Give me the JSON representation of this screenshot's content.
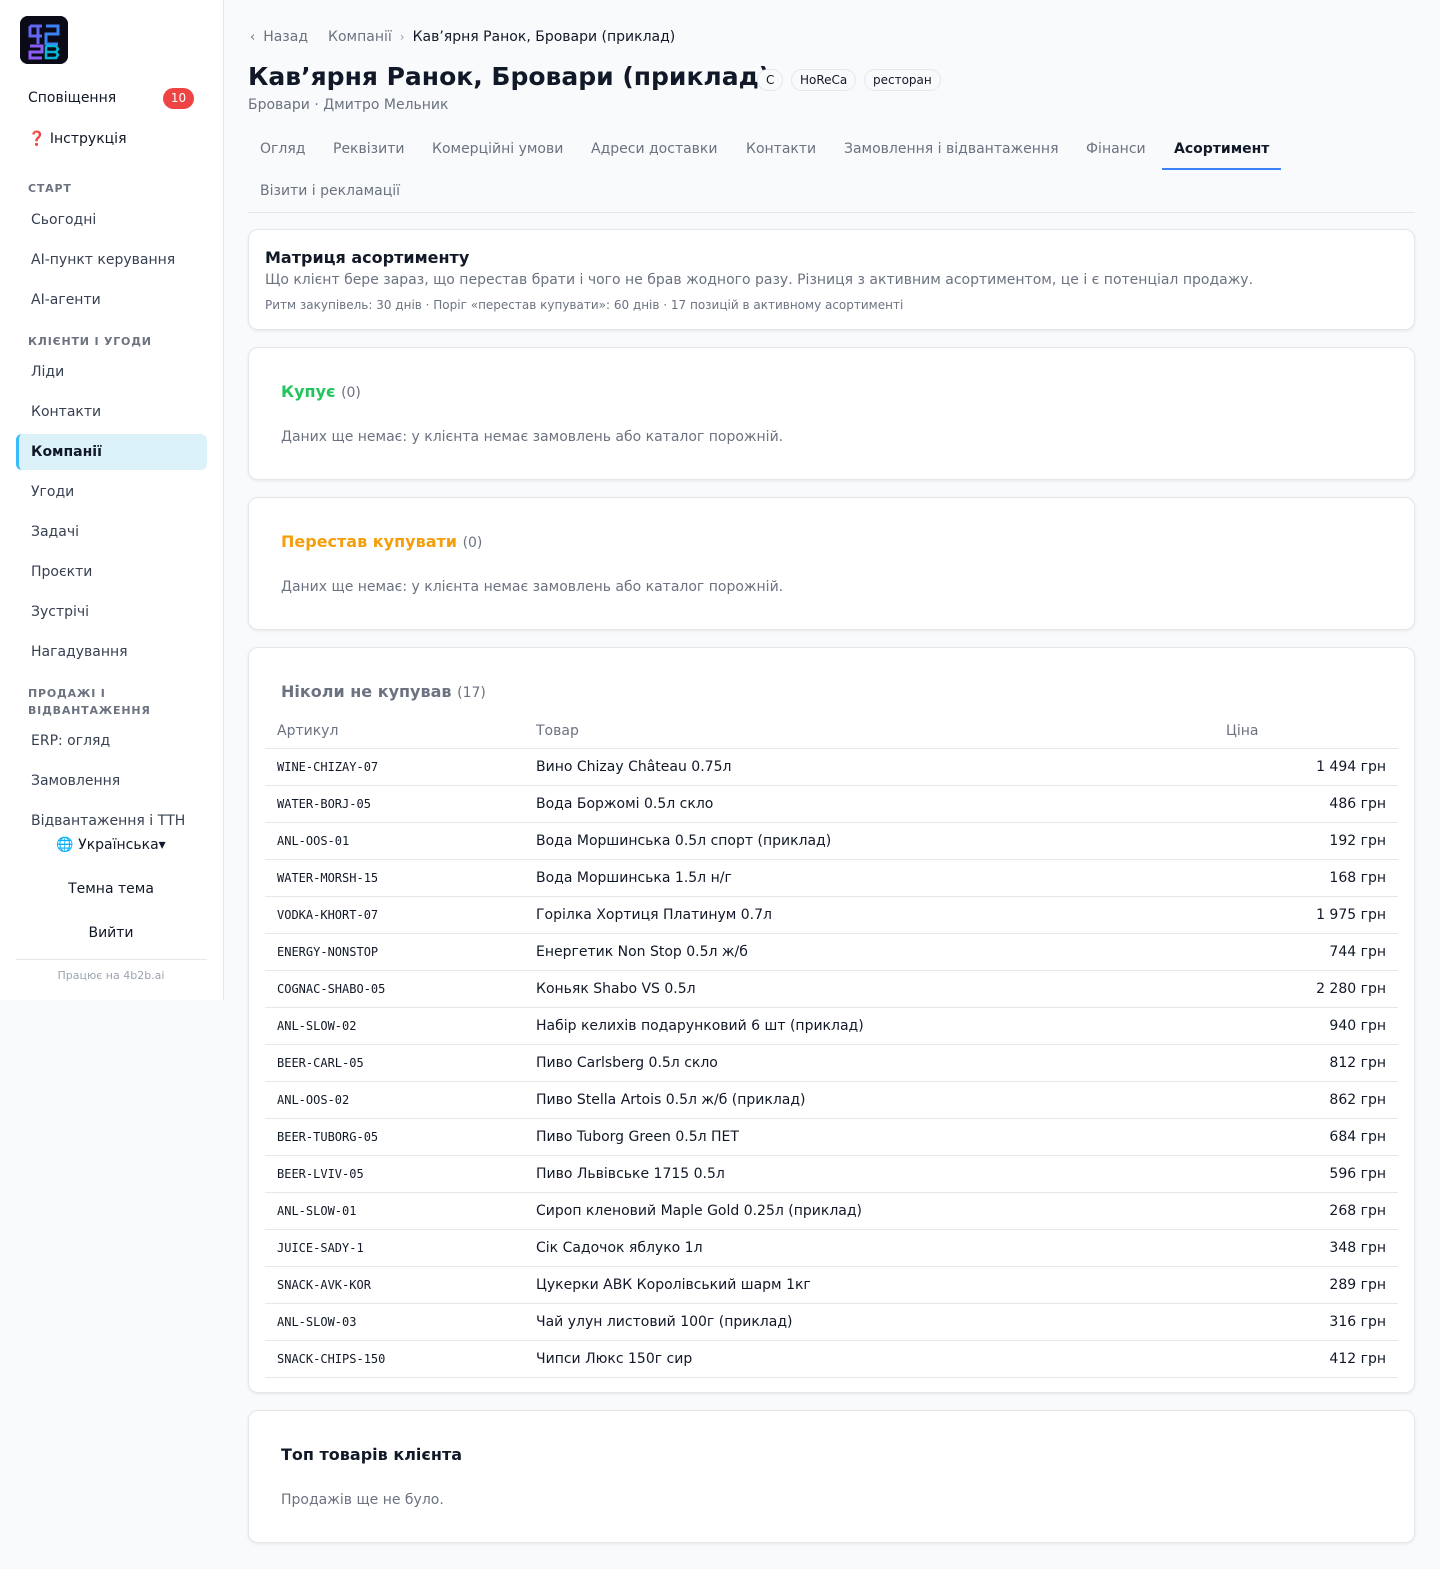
{
  "sidebar": {
    "logo_text": "4B2B",
    "notifications_label": "Сповіщення",
    "notifications_count": "10",
    "instruction_label": "❓ Інструкція",
    "sections": [
      {
        "label": "СТАРТ",
        "items": [
          "Сьогодні",
          "AI-пункт керування",
          "AI-агенти"
        ]
      },
      {
        "label": "КЛІЄНТИ І УГОДИ",
        "items": [
          "Ліди",
          "Контакти",
          "Компанії",
          "Угоди",
          "Задачі",
          "Проєкти",
          "Зустрічі",
          "Нагадування"
        ]
      },
      {
        "label": "ПРОДАЖІ І ВІДВАНТАЖЕННЯ",
        "items": [
          "ERP: огляд",
          "Замовлення",
          "Відвантаження і ТТН"
        ]
      }
    ],
    "language": "🌐 Українська▾",
    "theme_label": "Темна тема",
    "logout_label": "Вийти",
    "powered_by": "Працює на 4b2b.ai"
  },
  "breadcrumb": {
    "back": "Назад",
    "parent": "Компанії",
    "current": "Кав’ярня Ранок, Бровари (приклад)"
  },
  "company": {
    "title": "Кав’ярня Ранок, Бровари (приклад)",
    "chips": [
      "C",
      "HoReCa",
      "ресторан"
    ],
    "subtitle": "Бровари · Дмитро Мельник"
  },
  "tabs": [
    "Огляд",
    "Реквізити",
    "Комерційні умови",
    "Адреси доставки",
    "Контакти",
    "Замовлення і відвантаження",
    "Фінанси",
    "Асортимент",
    "Візити і рекламації"
  ],
  "active_tab": "Асортимент",
  "matrix": {
    "title": "Матриця асортименту",
    "description": "Що клієнт бере зараз, що перестав брати і чого не брав жодного разу. Різниця з активним асортиментом, це і є потенціал продажу.",
    "meta": "Ритм закупівель: 30 днів · Поріг «перестав купувати»: 60 днів · 17 позицій в активному асортименті"
  },
  "buying": {
    "title": "Купує",
    "count": "(0)",
    "empty": "Даних ще немає: у клієнта немає замовлень або каталог порожній.",
    "color": "#22c55e"
  },
  "stopped": {
    "title": "Перестав купувати",
    "count": "(0)",
    "empty": "Даних ще немає: у клієнта немає замовлень або каталог порожній.",
    "color": "#f59e0b"
  },
  "never": {
    "title": "Ніколи не купував",
    "count": "(17)",
    "columns": [
      "Артикул",
      "Товар",
      "Ціна"
    ],
    "rows": [
      {
        "sku": "WINE-CHIZAY-07",
        "name": "Вино Chizay Château 0.75л",
        "price": "1 494 грн"
      },
      {
        "sku": "WATER-BORJ-05",
        "name": "Вода Боржомі 0.5л скло",
        "price": "486 грн"
      },
      {
        "sku": "ANL-OOS-01",
        "name": "Вода Моршинська 0.5л спорт (приклад)",
        "price": "192 грн"
      },
      {
        "sku": "WATER-MORSH-15",
        "name": "Вода Моршинська 1.5л н/г",
        "price": "168 грн"
      },
      {
        "sku": "VODKA-KHORT-07",
        "name": "Горілка Хортиця Платинум 0.7л",
        "price": "1 975 грн"
      },
      {
        "sku": "ENERGY-NONSTOP",
        "name": "Енергетик Non Stop 0.5л ж/б",
        "price": "744 грн"
      },
      {
        "sku": "COGNAC-SHABO-05",
        "name": "Коньяк Shabo VS 0.5л",
        "price": "2 280 грн"
      },
      {
        "sku": "ANL-SLOW-02",
        "name": "Набір келихів подарунковий 6 шт (приклад)",
        "price": "940 грн"
      },
      {
        "sku": "BEER-CARL-05",
        "name": "Пиво Carlsberg 0.5л скло",
        "price": "812 грн"
      },
      {
        "sku": "ANL-OOS-02",
        "name": "Пиво Stella Artois 0.5л ж/б (приклад)",
        "price": "862 грн"
      },
      {
        "sku": "BEER-TUBORG-05",
        "name": "Пиво Tuborg Green 0.5л ПЕТ",
        "price": "684 грн"
      },
      {
        "sku": "BEER-LVIV-05",
        "name": "Пиво Львівське 1715 0.5л",
        "price": "596 грн"
      },
      {
        "sku": "ANL-SLOW-01",
        "name": "Сироп кленовий Maple Gold 0.25л (приклад)",
        "price": "268 грн"
      },
      {
        "sku": "JUICE-SADY-1",
        "name": "Сік Садочок яблуко 1л",
        "price": "348 грн"
      },
      {
        "sku": "SNACK-AVK-KOR",
        "name": "Цукерки АВК Королівський шарм 1кг",
        "price": "289 грн"
      },
      {
        "sku": "ANL-SLOW-03",
        "name": "Чай улун листовий 100г (приклад)",
        "price": "316 грн"
      },
      {
        "sku": "SNACK-CHIPS-150",
        "name": "Чипси Люкс 150г сир",
        "price": "412 грн"
      }
    ]
  },
  "top_products": {
    "title": "Топ товарів клієнта",
    "empty": "Продажів ще не було."
  }
}
